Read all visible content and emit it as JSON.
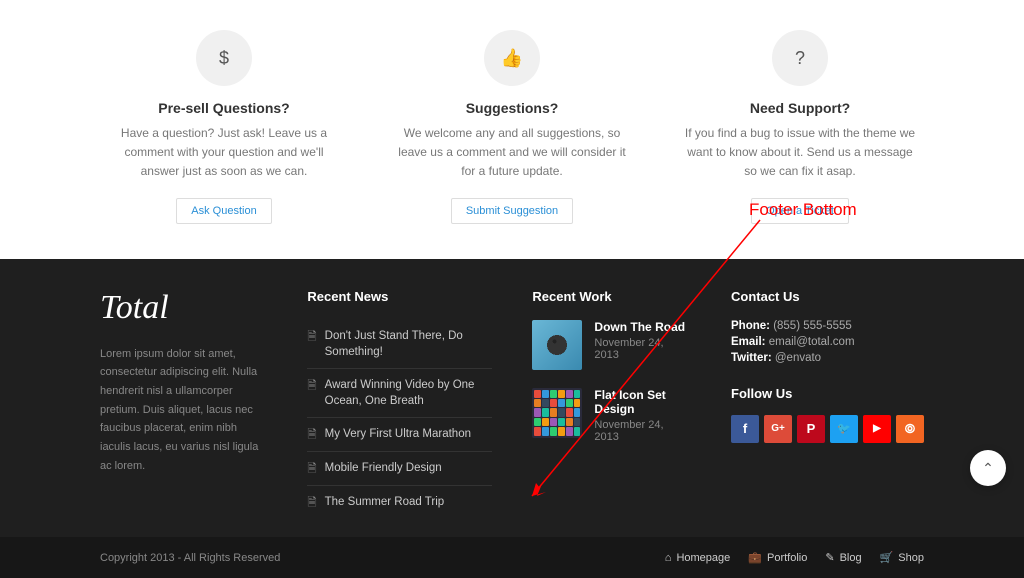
{
  "features": [
    {
      "icon": "$",
      "title": "Pre-sell Questions?",
      "desc": "Have a question? Just ask! Leave us a comment with your question and we'll answer just as soon as we can.",
      "button": "Ask Question"
    },
    {
      "icon": "👍",
      "title": "Suggestions?",
      "desc": "We welcome any and all suggestions, so leave us a comment and we will consider it for a future update.",
      "button": "Submit Suggestion"
    },
    {
      "icon": "?",
      "title": "Need Support?",
      "desc": "If you find a bug to issue with the theme we want to know about it. Send us a message so we can fix it asap.",
      "button": "Open a Ticket"
    }
  ],
  "brand": "Total",
  "about": "Lorem ipsum dolor sit amet, consectetur adipiscing elit. Nulla hendrerit nisl a ullamcorper pretium. Duis aliquet, lacus nec faucibus placerat, enim nibh iaculis lacus, eu varius nisl ligula ac lorem.",
  "footer_headings": {
    "news": "Recent News",
    "work": "Recent Work",
    "contact": "Contact Us",
    "follow": "Follow Us"
  },
  "news": [
    "Don't Just Stand There, Do Something!",
    "Award Winning Video by One Ocean, One Breath",
    "My Very First Ultra Marathon",
    "Mobile Friendly Design",
    "The Summer Road Trip"
  ],
  "work": [
    {
      "title": "Down The Road",
      "date": "November 24, 2013"
    },
    {
      "title": "Flat Icon Set Design",
      "date": "November 24, 2013"
    }
  ],
  "contact": {
    "phone_label": "Phone:",
    "phone": "(855) 555-5555",
    "email_label": "Email:",
    "email": "email@total.com",
    "twitter_label": "Twitter:",
    "twitter": "@envato"
  },
  "social": [
    {
      "name": "facebook",
      "glyph": "f"
    },
    {
      "name": "google-plus",
      "glyph": "G+"
    },
    {
      "name": "pinterest",
      "glyph": "P"
    },
    {
      "name": "twitter",
      "glyph": "🐦"
    },
    {
      "name": "youtube",
      "glyph": "▶"
    },
    {
      "name": "rss",
      "glyph": "⦾"
    }
  ],
  "copyright": "Copyright 2013 - All Rights Reserved",
  "bottom_nav": [
    {
      "label": "Homepage",
      "icon": "⌂"
    },
    {
      "label": "Portfolio",
      "icon": "💼"
    },
    {
      "label": "Blog",
      "icon": "✎"
    },
    {
      "label": "Shop",
      "icon": "🛒"
    }
  ],
  "annotation": "Footer Bottom"
}
